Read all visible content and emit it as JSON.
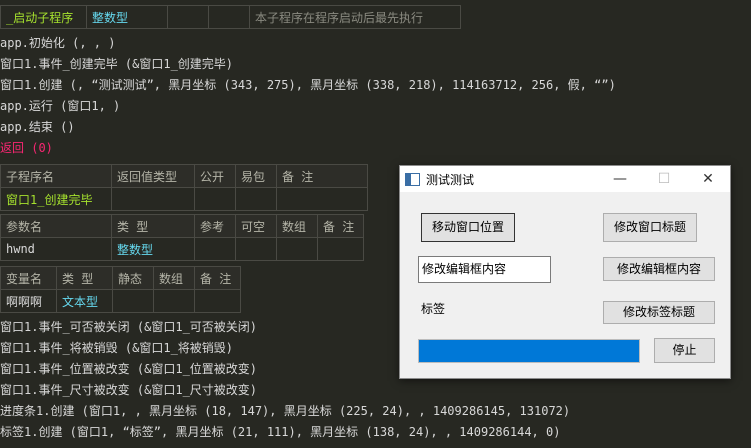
{
  "top_table": {
    "cells": [
      "_启动子程序",
      "整数型",
      "",
      "",
      "本子程序在程序启动后最先执行"
    ]
  },
  "code_top": [
    "app.初始化 (, , )",
    "窗口1.事件_创建完毕 (&窗口1_创建完毕)",
    "窗口1.创建 (, “测试测试”, 黑月坐标 (343, 275), 黑月坐标 (338, 218), 114163712, 256, 假, “”)",
    "app.运行 (窗口1, )",
    "app.结束 ()",
    "返回 (0)"
  ],
  "sub_table": {
    "header": [
      "子程序名",
      "返回值类型",
      "公开",
      "易包",
      "备 注"
    ],
    "row": [
      "窗口1_创建完毕",
      "",
      "",
      "",
      ""
    ]
  },
  "param_table": {
    "header": [
      "参数名",
      "类 型",
      "参考",
      "可空",
      "数组",
      "备 注"
    ],
    "row": [
      "hwnd",
      "整数型",
      "",
      "",
      "",
      ""
    ]
  },
  "var_table": {
    "header": [
      "变量名",
      "类 型",
      "静态",
      "数组",
      "备 注"
    ],
    "row": [
      "啊啊啊",
      "文本型",
      "",
      "",
      ""
    ]
  },
  "code_bottom": [
    "窗口1.事件_可否被关闭 (&窗口1_可否被关闭)",
    "窗口1.事件_将被销毁 (&窗口1_将被销毁)",
    "窗口1.事件_位置被改变 (&窗口1_位置被改变)",
    "窗口1.事件_尺寸被改变 (&窗口1_尺寸被改变)",
    "进度条1.创建 (窗口1, , 黑月坐标 (18, 147), 黑月坐标 (225, 24), , 1409286145, 131072)",
    "标签1.创建 (窗口1, “标签”, 黑月坐标 (21, 111), 黑月坐标 (138, 24), , 1409286144, 0)"
  ],
  "window": {
    "title": "测试测试",
    "minimize": "—",
    "maximize": "☐",
    "close": "✕",
    "btn_move": "移动窗口位置",
    "btn_title": "修改窗口标题",
    "edit_value": "修改编辑框内容",
    "btn_edit": "修改编辑框内容",
    "label": "标签",
    "btn_label": "修改标签标题",
    "btn_stop": "停止",
    "progress": 1.0,
    "progress_color": "#0078d7"
  }
}
